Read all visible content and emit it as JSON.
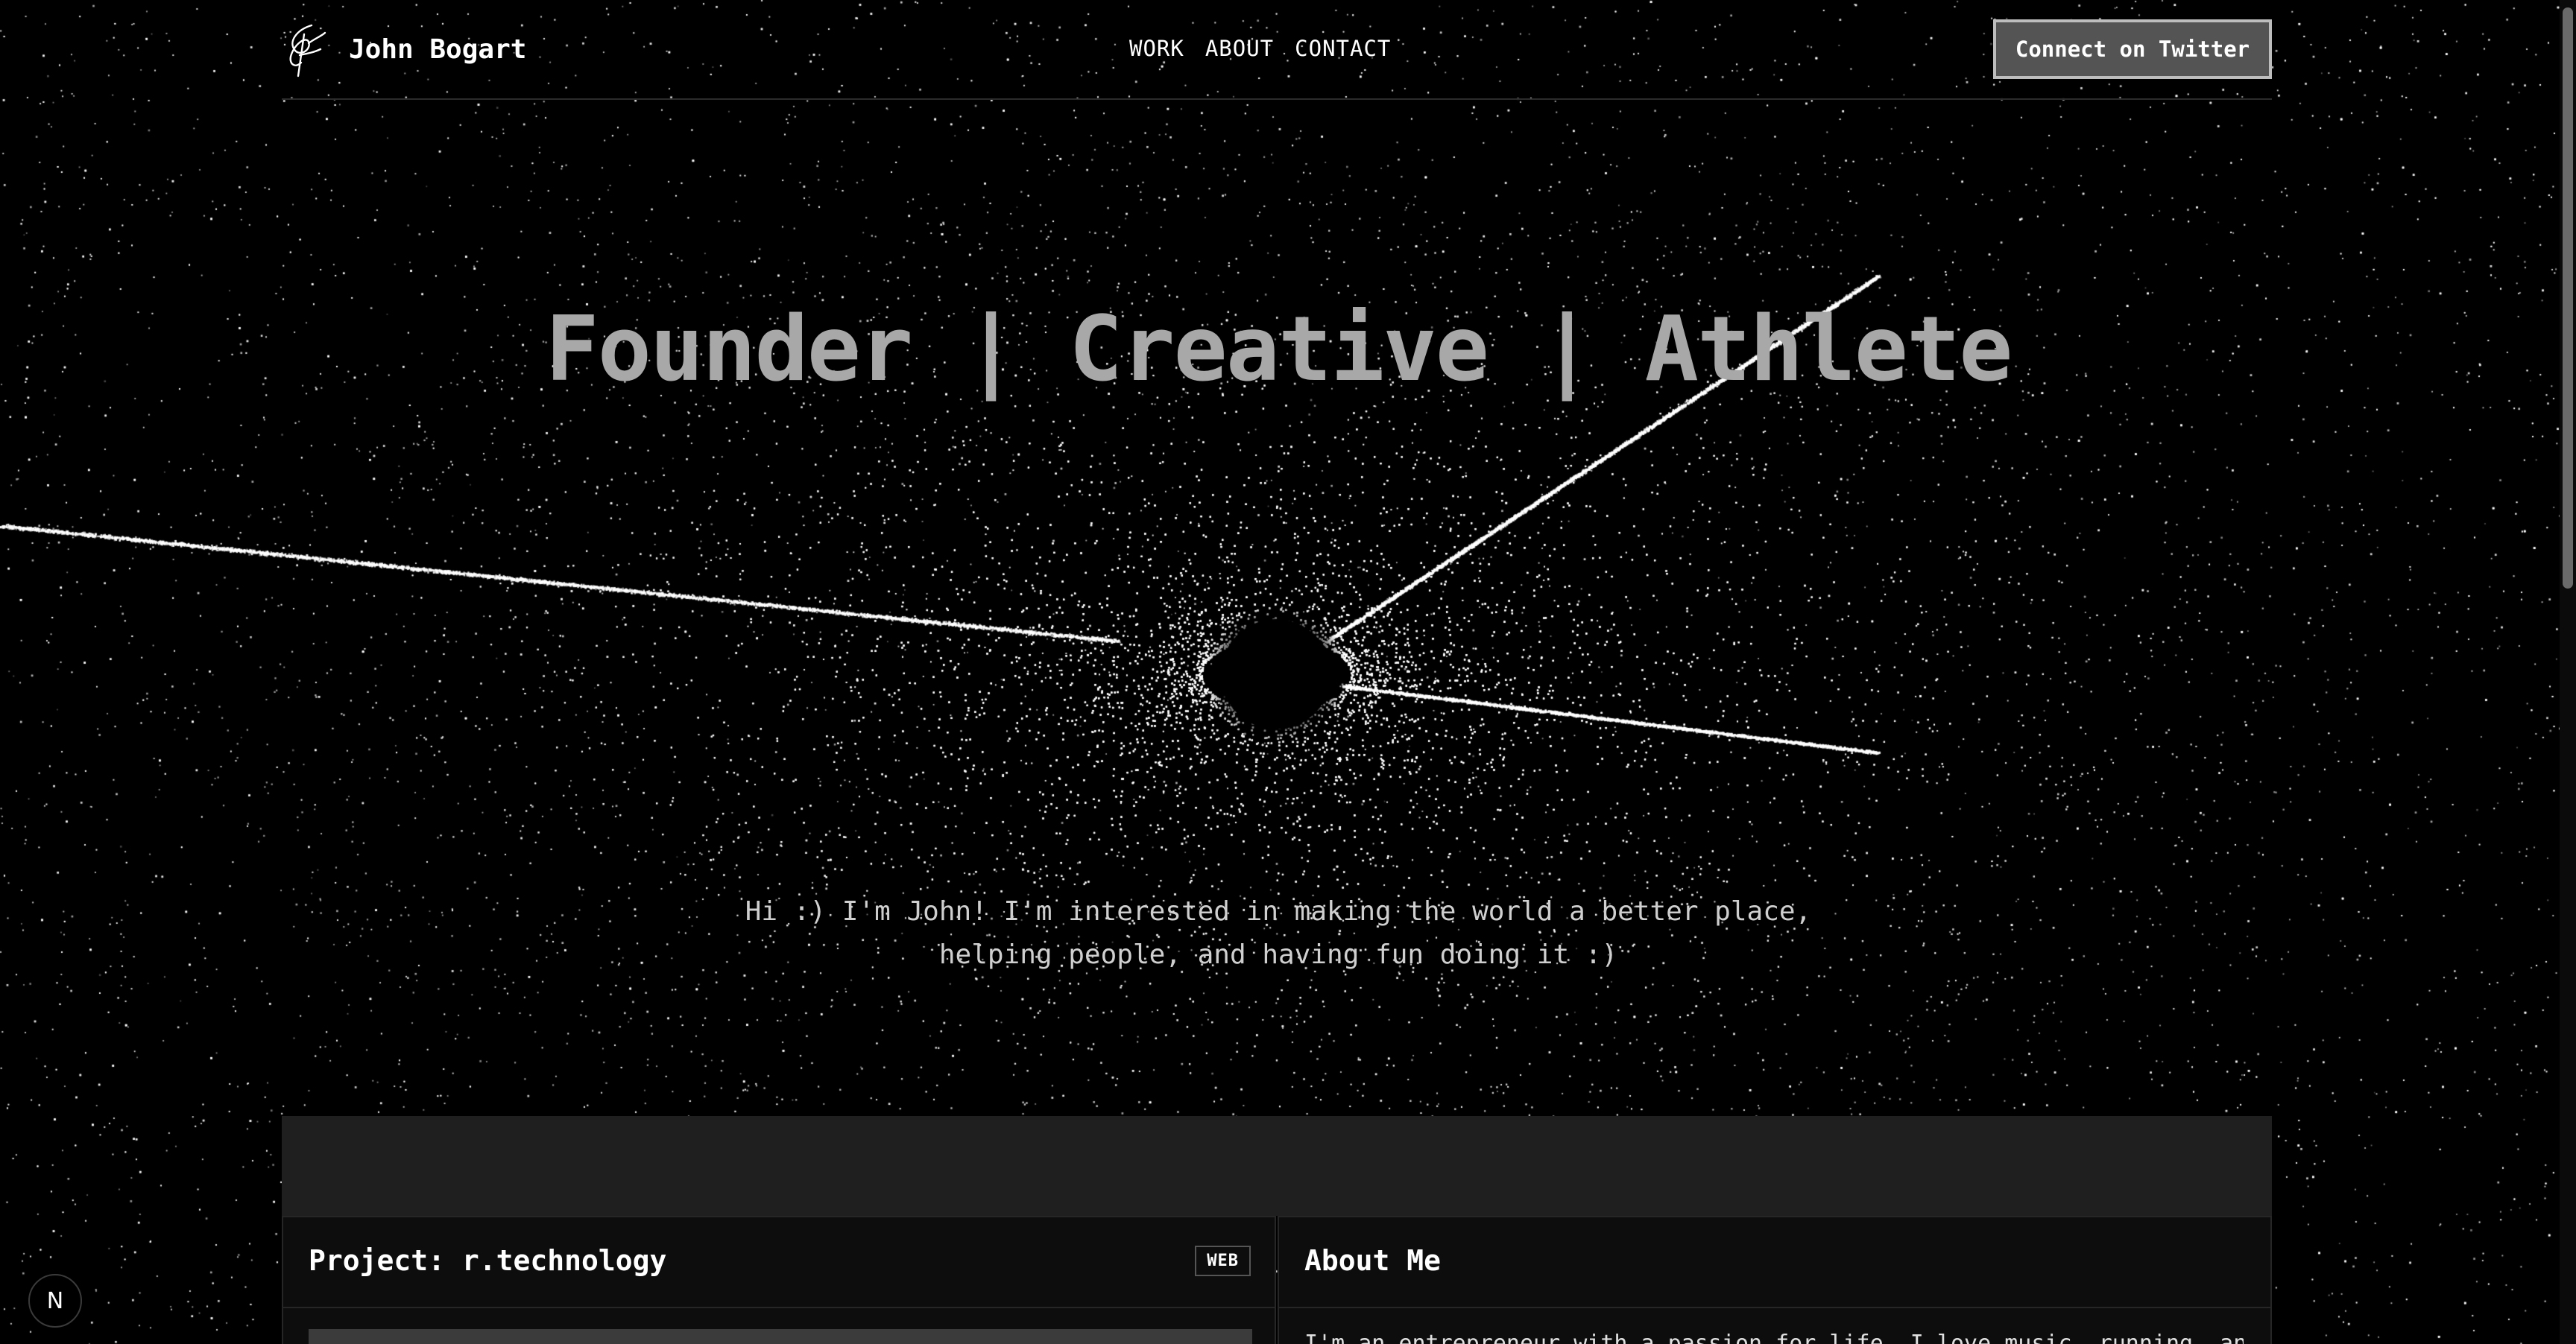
{
  "header": {
    "name": "John Bogart",
    "nav": [
      "WORK",
      "ABOUT",
      "CONTACT"
    ],
    "cta_label": "Connect on Twitter"
  },
  "hero": {
    "title": "Founder | Creative | Athlete",
    "subtitle_line1": "Hi :) I'm John! I'm interested in making the world a better place,",
    "subtitle_line2": "helping people, and having fun doing it :)"
  },
  "cards": {
    "project": {
      "title": "Project: r.technology",
      "badge": "WEB"
    },
    "about": {
      "title": "About Me",
      "text": "I'm an entrepreneur with a passion for life. I love music, running, and"
    }
  },
  "floating": {
    "dev_icon": "N",
    "icon_name": "nextjs-icon"
  },
  "colors": {
    "background": "#000000",
    "title": "#a8a8a8",
    "cta_bg": "#545454"
  }
}
